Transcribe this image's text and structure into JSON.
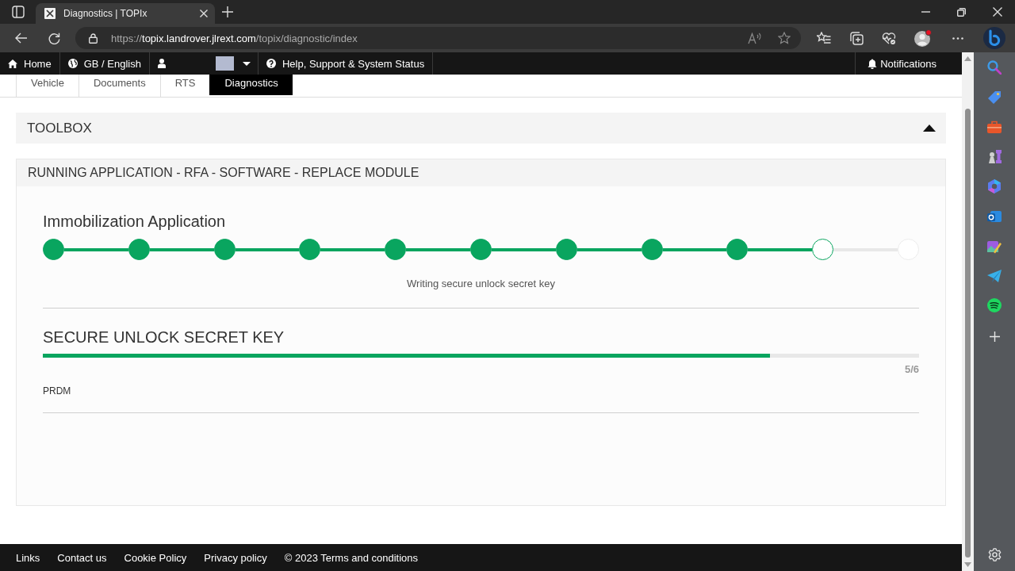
{
  "browser": {
    "tab_title": "Diagnostics | TOPIx",
    "url": {
      "scheme": "https://",
      "host": "topix.landrover.jlrext.com",
      "path": "/topix/diagnostic/index"
    }
  },
  "site_nav": {
    "items": [
      {
        "kind": "home",
        "label": "Home"
      },
      {
        "kind": "language",
        "label": "GB / English"
      },
      {
        "kind": "user"
      },
      {
        "kind": "help",
        "label": "Help, Support & System Status"
      }
    ],
    "notifications": "Notifications"
  },
  "tabs": [
    {
      "label": "Vehicle",
      "selected": false
    },
    {
      "label": "Documents",
      "selected": false
    },
    {
      "label": "RTS",
      "selected": false
    },
    {
      "label": "Diagnostics",
      "selected": true
    }
  ],
  "toolbox": {
    "title": "TOOLBOX",
    "expanded": true
  },
  "panel": {
    "title": "RUNNING APPLICATION - RFA - SOFTWARE - REPLACE MODULE",
    "application": "Immobilization Application",
    "steps": [
      {
        "done": true,
        "current": false
      },
      {
        "done": true,
        "current": false
      },
      {
        "done": true,
        "current": false
      },
      {
        "done": true,
        "current": false
      },
      {
        "done": true,
        "current": false
      },
      {
        "done": true,
        "current": false
      },
      {
        "done": true,
        "current": false
      },
      {
        "done": true,
        "current": false
      },
      {
        "done": true,
        "current": false
      },
      {
        "done": false,
        "current": true
      },
      {
        "done": false,
        "current": false
      }
    ],
    "step_caption": "Writing secure unlock secret key",
    "section": {
      "title": "SECURE UNLOCK SECRET KEY",
      "level": 0.83,
      "count": "5/6",
      "module": "PRDM"
    }
  },
  "footer": {
    "links": [
      "Links",
      "Contact us",
      "Cookie Policy",
      "Privacy policy",
      "© 2023 Terms and conditions"
    ]
  }
}
